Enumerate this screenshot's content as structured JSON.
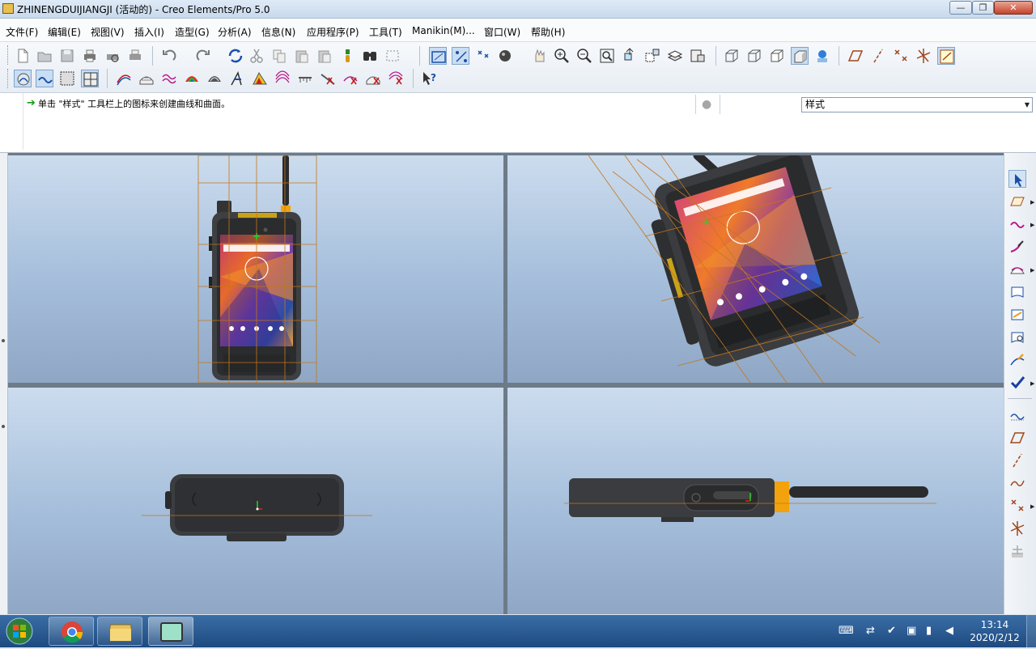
{
  "window": {
    "title": "ZHINENGDUIJIANGJI (活动的) - Creo Elements/Pro 5.0",
    "minimize_label": "—",
    "maximize_label": "❐",
    "close_label": "✕"
  },
  "menu": {
    "items": [
      {
        "label": "文件(F)"
      },
      {
        "label": "编辑(E)"
      },
      {
        "label": "视图(V)"
      },
      {
        "label": "插入(I)"
      },
      {
        "label": "造型(G)"
      },
      {
        "label": "分析(A)"
      },
      {
        "label": "信息(N)"
      },
      {
        "label": "应用程序(P)"
      },
      {
        "label": "工具(T)"
      },
      {
        "label": "Manikin(M)..."
      },
      {
        "label": "窗口(W)"
      },
      {
        "label": "帮助(H)"
      }
    ]
  },
  "message": {
    "text": "单击 \"样式\" 工具栏上的图标来创建曲线和曲面。"
  },
  "style_selector": {
    "value": "样式"
  },
  "toolbar_row1": [
    "new-icon",
    "open-icon",
    "save-icon",
    "print-icon",
    "print-preview-icon",
    "quick-print-icon",
    "undo-icon",
    "redo-icon",
    "regenerate-icon",
    "cut-icon",
    "copy-icon",
    "paste-icon",
    "paste-special-icon",
    "model-tree-icon",
    "find-icon",
    "select-box-icon",
    "datum-plane-display-icon",
    "datum-axis-display-icon",
    "datum-point-display-icon",
    "csys-display-icon",
    "pan-icon",
    "zoom-in-icon",
    "zoom-out-icon",
    "refit-icon",
    "reorient-icon",
    "saved-views-icon",
    "layers-icon",
    "view-manager-icon",
    "wireframe-icon",
    "hidden-line-icon",
    "no-hidden-icon",
    "shading-icon",
    "shading-edges-icon",
    "plane-tool-icon",
    "axis-tool-icon",
    "point-tool-icon",
    "csys-tool-icon",
    "sketch-tool-icon"
  ],
  "toolbar_row2": [
    "style-curve-icon",
    "style-surface-icon",
    "curve-edit-icon",
    "surface-edit-icon",
    "curvature-icon",
    "reflection-icon",
    "shading-analysis-icon",
    "slope-icon",
    "dihedral-icon",
    "section-icon",
    "draft-icon",
    "offset-icon",
    "delete-curve-icon",
    "delete-surface-icon",
    "delete-all-icon",
    "context-help-icon"
  ],
  "right_toolbar": [
    {
      "icon": "select-arrow-icon",
      "active": true
    },
    {
      "icon": "active-plane-icon"
    },
    {
      "icon": "curve-icon"
    },
    {
      "icon": "curve-on-surface-icon"
    },
    {
      "icon": "surface-icon"
    },
    {
      "icon": "surface-connect-icon"
    },
    {
      "icon": "surface-trim-icon"
    },
    {
      "icon": "surface-edit-tool-icon"
    },
    {
      "icon": "curve-analysis-icon"
    },
    {
      "icon": "done-check-icon"
    },
    {
      "icon": "plane-display-icon"
    },
    {
      "icon": "datum-plane-icon"
    },
    {
      "icon": "datum-axis-icon"
    },
    {
      "icon": "datum-curve-icon"
    },
    {
      "icon": "datum-point-icon"
    },
    {
      "icon": "datum-csys-icon"
    },
    {
      "icon": "datum-csys-disabled-icon"
    }
  ],
  "viewports": [
    {
      "name": "front",
      "view": "front"
    },
    {
      "name": "isometric",
      "view": "isometric"
    },
    {
      "name": "top",
      "view": "top"
    },
    {
      "name": "side",
      "view": "side"
    }
  ],
  "taskbar": {
    "apps": [
      "chrome-icon",
      "file-explorer-icon",
      "creo-icon"
    ],
    "time": "13:14",
    "date": "2020/2/12"
  },
  "colors": {
    "viewport_top": "#ccdcee",
    "viewport_bottom": "#8fa7c5",
    "model_body": "#3d3f42",
    "accent_orange": "#f2a20c",
    "datum_orange": "#d6891a",
    "taskbar": "#2a5d93"
  }
}
